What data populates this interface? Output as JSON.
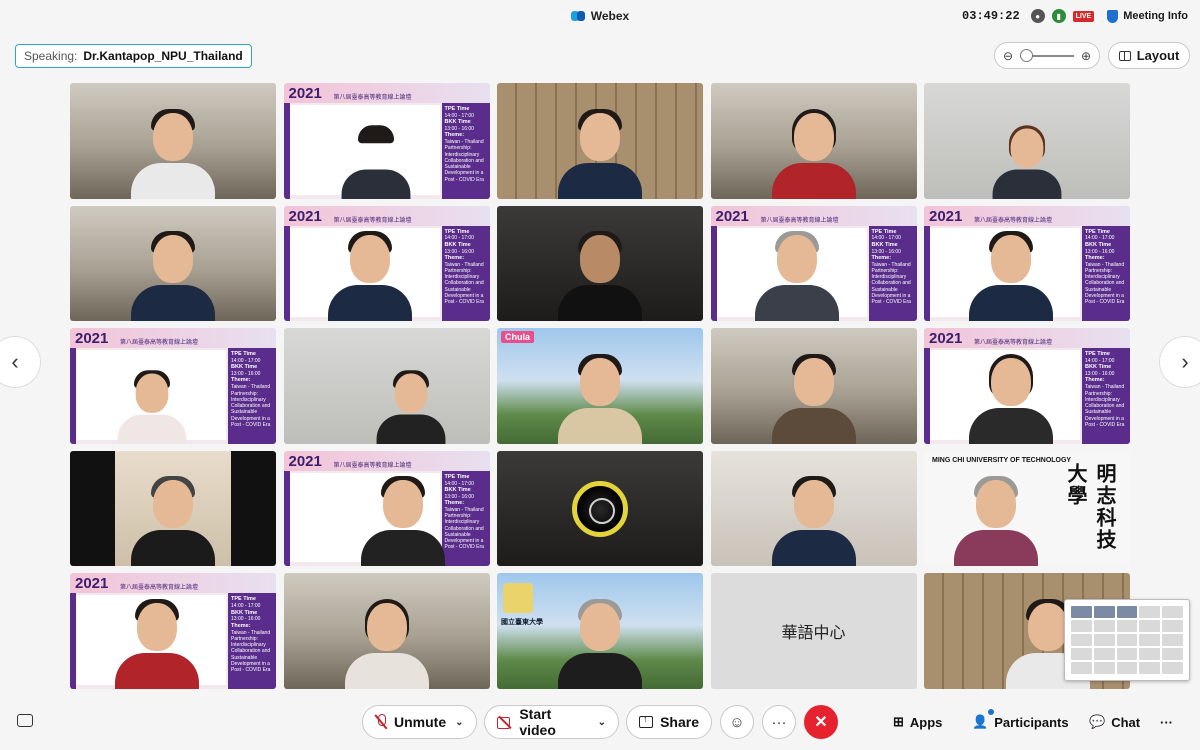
{
  "title": {
    "app_name": "Webex",
    "clock": "03:49:22",
    "live_badge": "LIVE",
    "meeting_info": "Meeting Info"
  },
  "speaking": {
    "label": "Speaking:",
    "name": "Dr.Kantapop_NPU_Thailand"
  },
  "view": {
    "layout_label": "Layout"
  },
  "forum_bg": {
    "year": "2021",
    "title": "第八屆臺泰高等教育線上論壇",
    "tpe_label": "TPE Time",
    "tpe_time": "14:00 - 17:00",
    "bkk_label": "BKK Time",
    "bkk_time": "13:00 - 16:00",
    "theme_label": "Theme:",
    "theme": "Taiwan - Thailand Partnership: Interdisciplinary Collaboration and Sustainable Development in a Post - COVID Era"
  },
  "tiles": {
    "chula": "Chula",
    "ming_chi_name": "MING CHI UNIVERSITY OF TECHNOLOGY",
    "ming_chi_chars": "明志科技大學",
    "ntu_text": "國立臺東大學",
    "chinese_center": "華語中心"
  },
  "controls": {
    "unmute": "Unmute",
    "start_video": "Start video",
    "share": "Share",
    "apps": "Apps",
    "participants": "Participants",
    "chat": "Chat"
  },
  "colors": {
    "end_call": "#e5222e",
    "accent": "#1f6fd1",
    "speaking_border": "#2fa3c8"
  }
}
